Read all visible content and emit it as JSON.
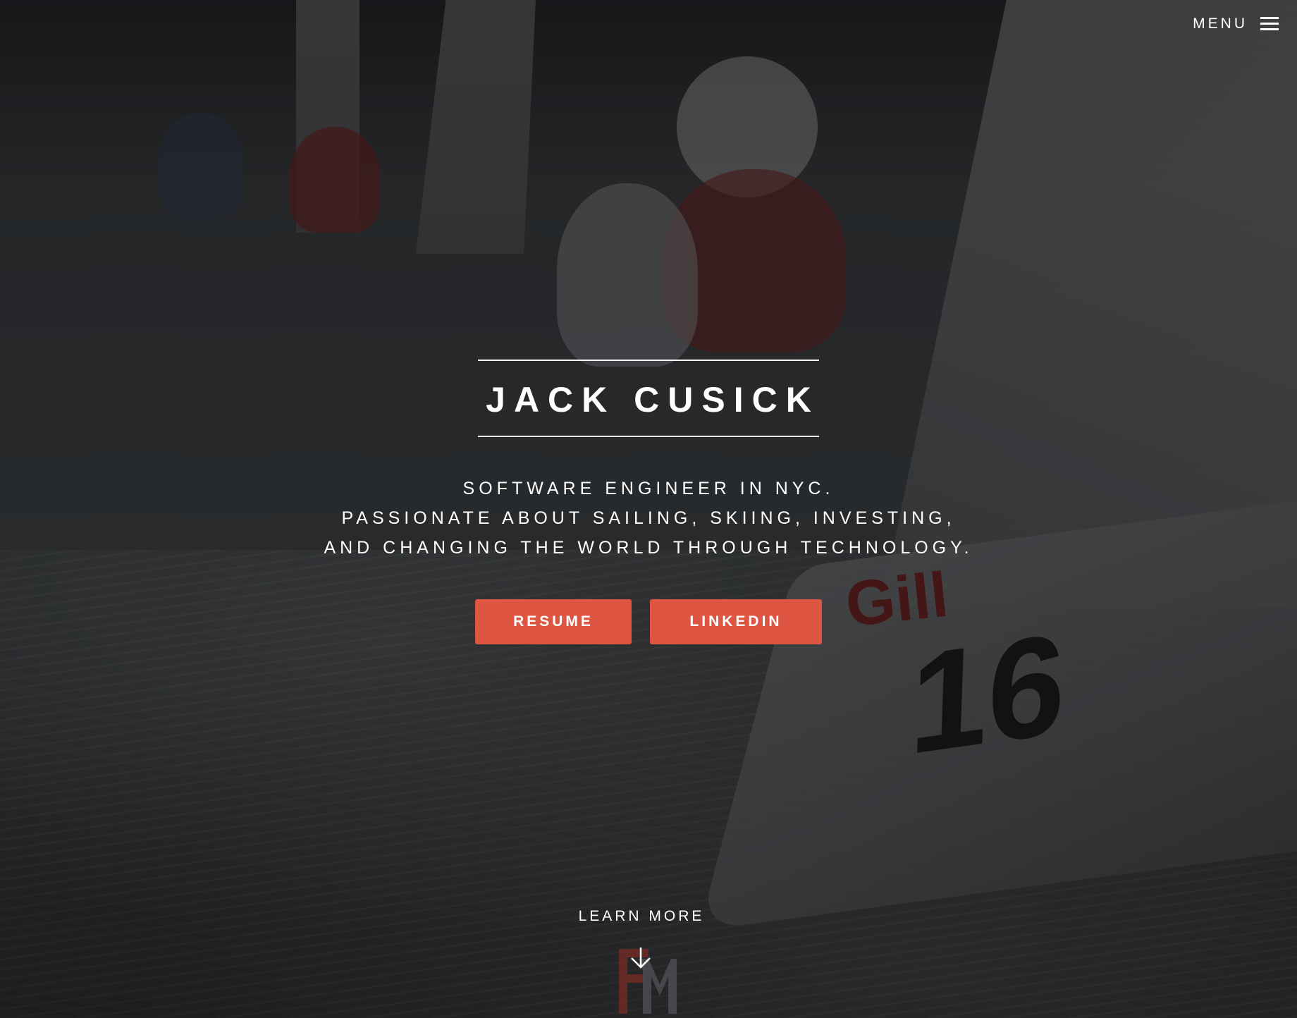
{
  "header": {
    "menu_label": "MENU"
  },
  "hero": {
    "name": "JACK CUSICK",
    "tagline": [
      "SOFTWARE ENGINEER IN NYC.",
      "PASSIONATE ABOUT SAILING, SKIING, INVESTING,",
      "AND CHANGING THE WORLD THROUGH TECHNOLOGY."
    ],
    "buttons": {
      "resume": "RESUME",
      "linkedin": "LINKEDIN"
    },
    "learn_more": "LEARN MORE"
  },
  "icons": {
    "menu": "hamburger-icon",
    "scroll": "arrow-down-icon",
    "logo": "fm-monogram-logo"
  },
  "colors": {
    "accent": "#de5541",
    "text": "#ffffff",
    "logo": "#6b2a26"
  }
}
